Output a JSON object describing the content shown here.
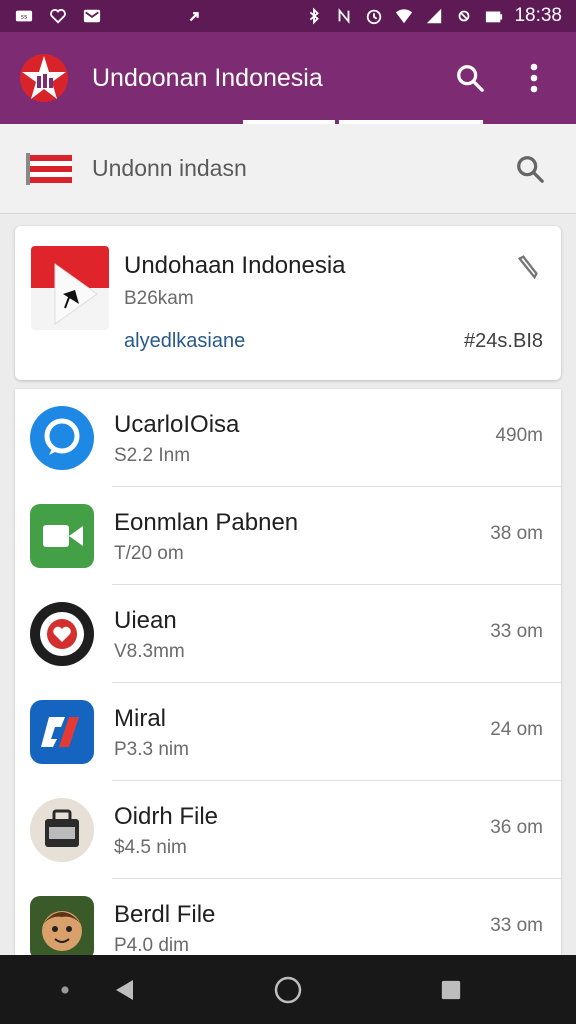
{
  "status_bar": {
    "time": "18:38",
    "icons": [
      "carrier-icon",
      "heart-icon",
      "mail-icon",
      "cast-icon",
      "bluetooth-icon",
      "nfc-icon",
      "alarm-icon",
      "wifi-icon",
      "signal-icon",
      "no-sim-icon",
      "battery-icon"
    ]
  },
  "app_bar": {
    "title": "Undoonan Indonesia",
    "background": "#7d2b72",
    "status_background": "#5e1a55"
  },
  "search": {
    "placeholder": "Undonn indasn"
  },
  "featured": {
    "title": "Undohaan Indonesia",
    "subtitle": "B26kam",
    "link": "alyedlkasiane",
    "meta": "#24s.BI8"
  },
  "list": {
    "items": [
      {
        "name": "UcarloIOisa",
        "size": "S2.2 Inm",
        "meta": "490m",
        "icon": "chat-bubble-icon",
        "color": "#1e88e5"
      },
      {
        "name": "Eonmlan Pabnen",
        "size": "T/20 om",
        "meta": "38 om",
        "icon": "video-call-icon",
        "color": "#43a047"
      },
      {
        "name": "Uiean",
        "size": "V8.3mm",
        "meta": "33 om",
        "icon": "heart-camera-icon",
        "color": "#1e1e1e"
      },
      {
        "name": "Miral",
        "size": "P3.3 nim",
        "meta": "24 om",
        "icon": "slash-logo-icon",
        "color": "#1565c0"
      },
      {
        "name": "Oidrh File",
        "size": "$4.5 nim",
        "meta": "36 om",
        "icon": "archive-icon",
        "color": "#e6e0d6"
      },
      {
        "name": "Berdl File",
        "size": "P4.0 dim",
        "meta": "33 om",
        "icon": "face-avatar-icon",
        "color": "#3b5a2a"
      }
    ]
  }
}
